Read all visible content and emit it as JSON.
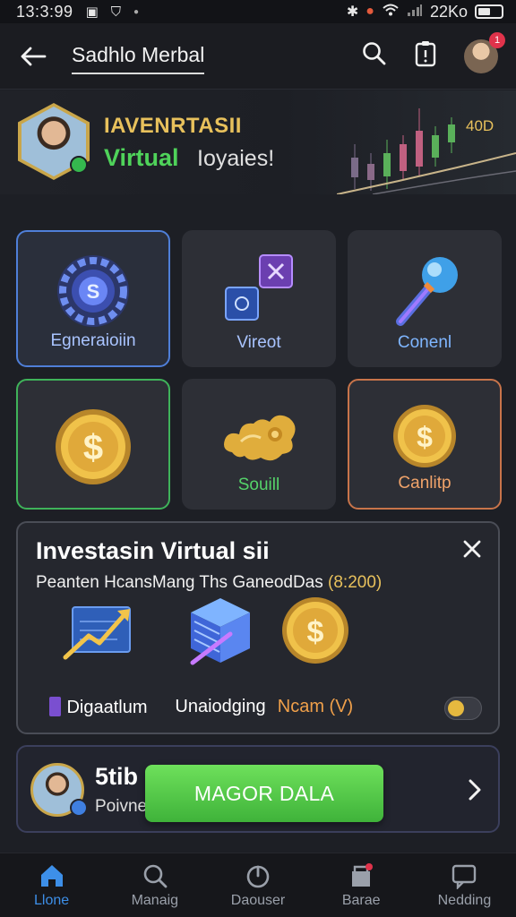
{
  "status_bar": {
    "time": "13:3:99",
    "signal_label": "22Ko"
  },
  "header": {
    "title": "Sadhlo Merbal",
    "notification_count": "1"
  },
  "banner": {
    "kicker": "IAVENRTASII",
    "subtitle_highlight": "Virtual",
    "subtitle_rest": "Ioyaies!",
    "price_tag": "40D"
  },
  "tiles": [
    {
      "label": "Egneraioiin",
      "icon": "gear-coin-icon",
      "label_color": "#a9c4ff",
      "border": "#4f7fd8"
    },
    {
      "label": "Vireot",
      "icon": "connected-blocks-icon",
      "label_color": "#a9c4ff",
      "border": "none"
    },
    {
      "label": "Conenl",
      "icon": "microphone-icon",
      "label_color": "#7fb6ff",
      "border": "none"
    },
    {
      "label": "",
      "icon": "gold-coin-icon",
      "label_color": "#ffffff",
      "border": "#3fb35a"
    },
    {
      "label": "Souill",
      "icon": "gold-cloud-icon",
      "label_color": "#55d36a",
      "border": "none"
    },
    {
      "label": "Canlitp",
      "icon": "gold-coin-icon",
      "label_color": "#f0a36a",
      "border": "#c8744a"
    }
  ],
  "invest_card": {
    "title": "Investasin Virtual sii",
    "description": "Peanten HcansMang Ths GaneodDas",
    "amount": "8:200",
    "items": [
      {
        "label": "Digaatlum",
        "icon": "chart-growth-icon",
        "color": "#ffffff"
      },
      {
        "label": "Unaiodging",
        "icon": "stacked-cubes-icon",
        "color": "#ffffff"
      },
      {
        "label": "Ncam (V)",
        "icon": "gold-coin-icon",
        "color": "#f0a04a"
      }
    ]
  },
  "promo_card": {
    "title": "5tib",
    "subtitle": "Poivne",
    "cta_label": "MAGOR DALA"
  },
  "bottom_nav": [
    {
      "label": "Llone",
      "icon": "home-icon",
      "active": true
    },
    {
      "label": "Manaig",
      "icon": "search-icon",
      "active": false
    },
    {
      "label": "Daouser",
      "icon": "power-icon",
      "active": false
    },
    {
      "label": "Barae",
      "icon": "store-icon",
      "active": false
    },
    {
      "label": "Nedding",
      "icon": "chat-icon",
      "active": false
    }
  ]
}
